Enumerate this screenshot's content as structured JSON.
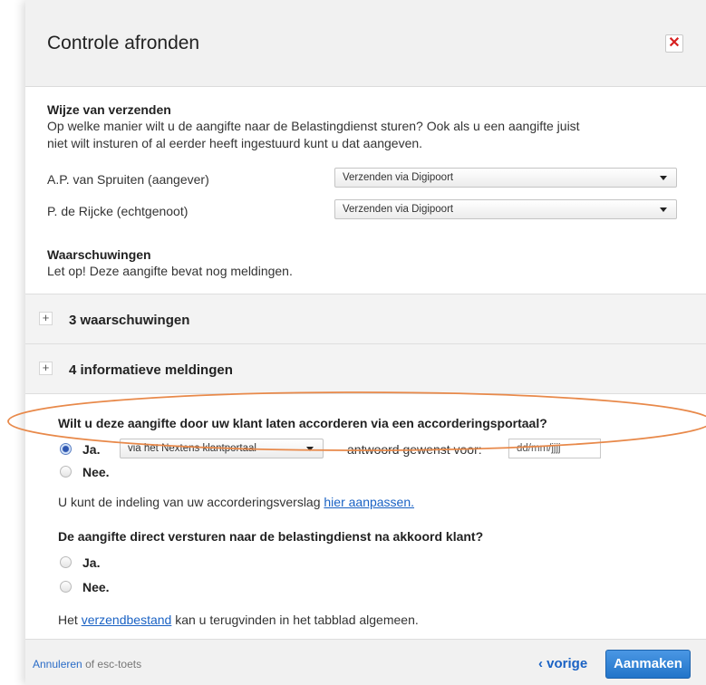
{
  "dialog": {
    "title": "Controle afronden",
    "close_label": "✕"
  },
  "send_method": {
    "heading": "Wijze van verzenden",
    "description_line1": "Op welke manier wilt u de aangifte naar de Belastingdienst sturen? Ook als u een aangifte juist",
    "description_line2": "niet wilt insturen of al eerder heeft ingestuurd kunt u dat aangeven.",
    "rows": [
      {
        "person": "A.P. van Spruiten (aangever)",
        "selected": "Verzenden via Digipoort"
      },
      {
        "person": "P. de Rijcke (echtgenoot)",
        "selected": "Verzenden via Digipoort"
      }
    ]
  },
  "warnings": {
    "heading": "Waarschuwingen",
    "text": "Let op! Deze aangifte bevat nog meldingen."
  },
  "accordions": [
    {
      "label": "3 waarschuwingen",
      "icon": "+"
    },
    {
      "label": "4 informatieve meldingen",
      "icon": "+"
    }
  ],
  "approval": {
    "question": "Wilt u deze aangifte door uw klant laten accorderen via een accorderingsportaal?",
    "yes_label": "Ja.",
    "no_label": "Nee.",
    "yes_checked": true,
    "portal_selected": "via het Nextens klantportaal",
    "deadline_label": "antwoord gewenst voor:",
    "date_placeholder": "dd/mm/jjjj",
    "report_text": "U kunt de indeling van uw accorderingsverslag",
    "report_link": "hier aanpassen."
  },
  "direct_send": {
    "question": "De aangifte direct versturen naar de belastingdienst na akkoord klant?",
    "yes_label": "Ja.",
    "no_label": "Nee.",
    "file_text_before": "Het",
    "file_link": "verzendbestand",
    "file_text_after": "kan u terugvinden in het tabblad algemeen."
  },
  "footer": {
    "cancel_link": "Annuleren",
    "cancel_suffix": "of esc-toets",
    "prev_label": "‹ vorige",
    "create_label": "Aanmaken"
  },
  "colors": {
    "highlight_ellipse": "#e8894a",
    "link": "#1a62c4",
    "primary_button": "#2d7fd3",
    "close_x": "#d72020"
  }
}
